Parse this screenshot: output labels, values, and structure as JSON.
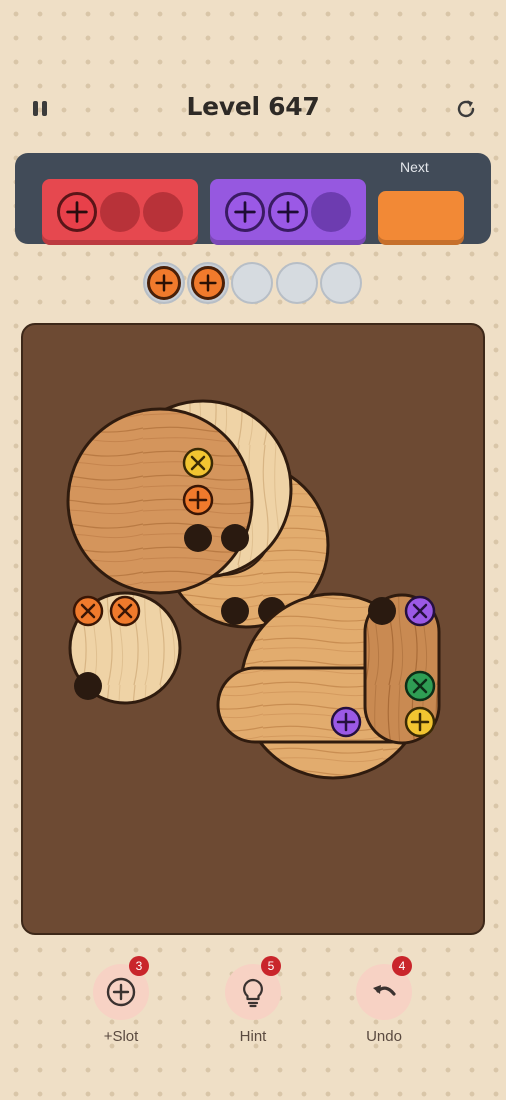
{
  "header": {
    "level_title": "Level 647"
  },
  "tray": {
    "next_label": "Next",
    "boxes": [
      {
        "color": "red",
        "hex": "#e6484f",
        "filled": 1,
        "capacity": 3
      },
      {
        "color": "purple",
        "hex": "#9658e0",
        "filled": 2,
        "capacity": 3
      },
      {
        "color": "orange",
        "hex": "#f28936",
        "filled": 0,
        "capacity": 3,
        "state": "next"
      }
    ]
  },
  "slots": {
    "filled": [
      "orange",
      "orange"
    ],
    "total": 5
  },
  "board": {
    "screws": [
      {
        "color": "yellow",
        "mark": "x"
      },
      {
        "color": "orange",
        "mark": "plus"
      },
      {
        "color": "orange",
        "mark": "x"
      },
      {
        "color": "orange",
        "mark": "x"
      },
      {
        "color": "purple",
        "mark": "x"
      },
      {
        "color": "green",
        "mark": "x"
      },
      {
        "color": "purple",
        "mark": "plus"
      },
      {
        "color": "yellow",
        "mark": "plus"
      }
    ]
  },
  "tools": {
    "add_slot": {
      "label": "+Slot",
      "count": "3",
      "icon": "plus-circle-icon"
    },
    "hint": {
      "label": "Hint",
      "count": "5",
      "icon": "lightbulb-icon"
    },
    "undo": {
      "label": "Undo",
      "count": "4",
      "icon": "undo-arrow-icon"
    }
  },
  "colors": {
    "red": "#e6484f",
    "purple": "#9658e0",
    "orange": "#f28936",
    "yellow": "#f2c531",
    "green": "#2f9e54",
    "board": "#6d4a33",
    "badge": "#c9252b"
  }
}
